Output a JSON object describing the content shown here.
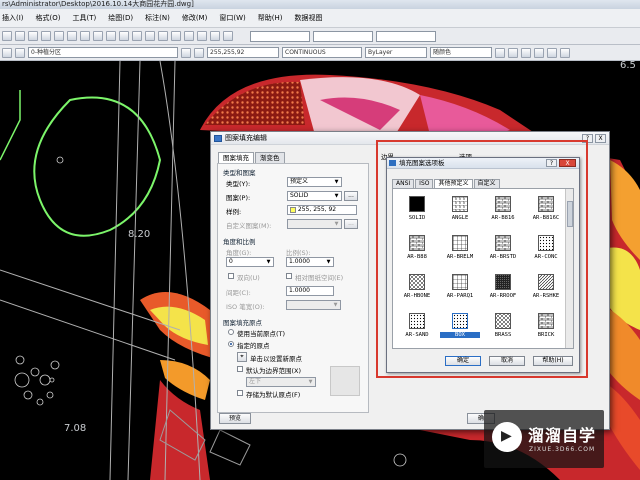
{
  "window": {
    "title": "rs\\Administrator\\Desktop\\2016.10.14大商园花卉园.dwg]"
  },
  "menu": [
    "插入(I)",
    "格式(O)",
    "工具(T)",
    "绘图(D)",
    "标注(N)",
    "修改(M)",
    "窗口(W)",
    "帮助(H)",
    "数据视图"
  ],
  "toolbar": {
    "layer": "0-种植分区",
    "color": "255,255,92",
    "linetype": "CONTINUOUS",
    "lineweight": "ByLayer",
    "plotstyle": "随颜色"
  },
  "cad": {
    "labels": [
      "8.20",
      "7.08",
      "6.5"
    ]
  },
  "dialog": {
    "title": "图案填充编辑",
    "tabs": [
      "图案填充",
      "渐变色"
    ],
    "type_section": "类型和图案",
    "type_label": "类型(Y):",
    "type_value": "预定义",
    "pattern_label": "图案(P):",
    "pattern_value": "SOLID",
    "swatch_label": "样例:",
    "swatch_value": "255, 255, 92",
    "custom_label": "自定义图案(M):",
    "angle_section": "角度和比例",
    "angle_label": "角度(G):",
    "angle_value": "0",
    "scale_label": "比例(S):",
    "scale_value": "1.0000",
    "double_label": "双向(U)",
    "relative_label": "相对图纸空间(E)",
    "spacing_label": "间距(C):",
    "spacing_value": "1.0000",
    "iso_label": "ISO 笔宽(O):",
    "origin_section": "图案填充原点",
    "use_current": "使用当前原点(T)",
    "specified": "指定的原点",
    "click_set": "单击以设置新原点",
    "default_boundary": "默认为边界范围(X)",
    "position_value": "左下",
    "store_default": "存储为默认原点(F)",
    "preview_button": "预览",
    "boundary_label": "边界",
    "options_label": "选项",
    "help_q": "?",
    "close_x": "X",
    "ok_text": "确"
  },
  "palette": {
    "title": "填充图案选项板",
    "help_btn": "?",
    "close_btn": "X",
    "tabs": [
      "ANSI",
      "ISO",
      "其他预定义",
      "自定义"
    ],
    "active_tab": 2,
    "patterns": [
      "SOLID",
      "ANGLE",
      "AR-B816",
      "AR-B816C",
      "AR-B88",
      "AR-BRELM",
      "AR-BRSTD",
      "AR-CONC",
      "AR-HBONE",
      "AR-PARQ1",
      "AR-RROOF",
      "AR-RSHKE",
      "AR-SAND",
      "BOX",
      "BRASS",
      "BRICK"
    ],
    "selected": "BOX",
    "buttons": {
      "ok": "确定",
      "cancel": "取消",
      "help": "帮助(H)"
    }
  },
  "watermark": {
    "brand": "溜溜自学",
    "url": "ZIXUE.3D66.COM"
  }
}
